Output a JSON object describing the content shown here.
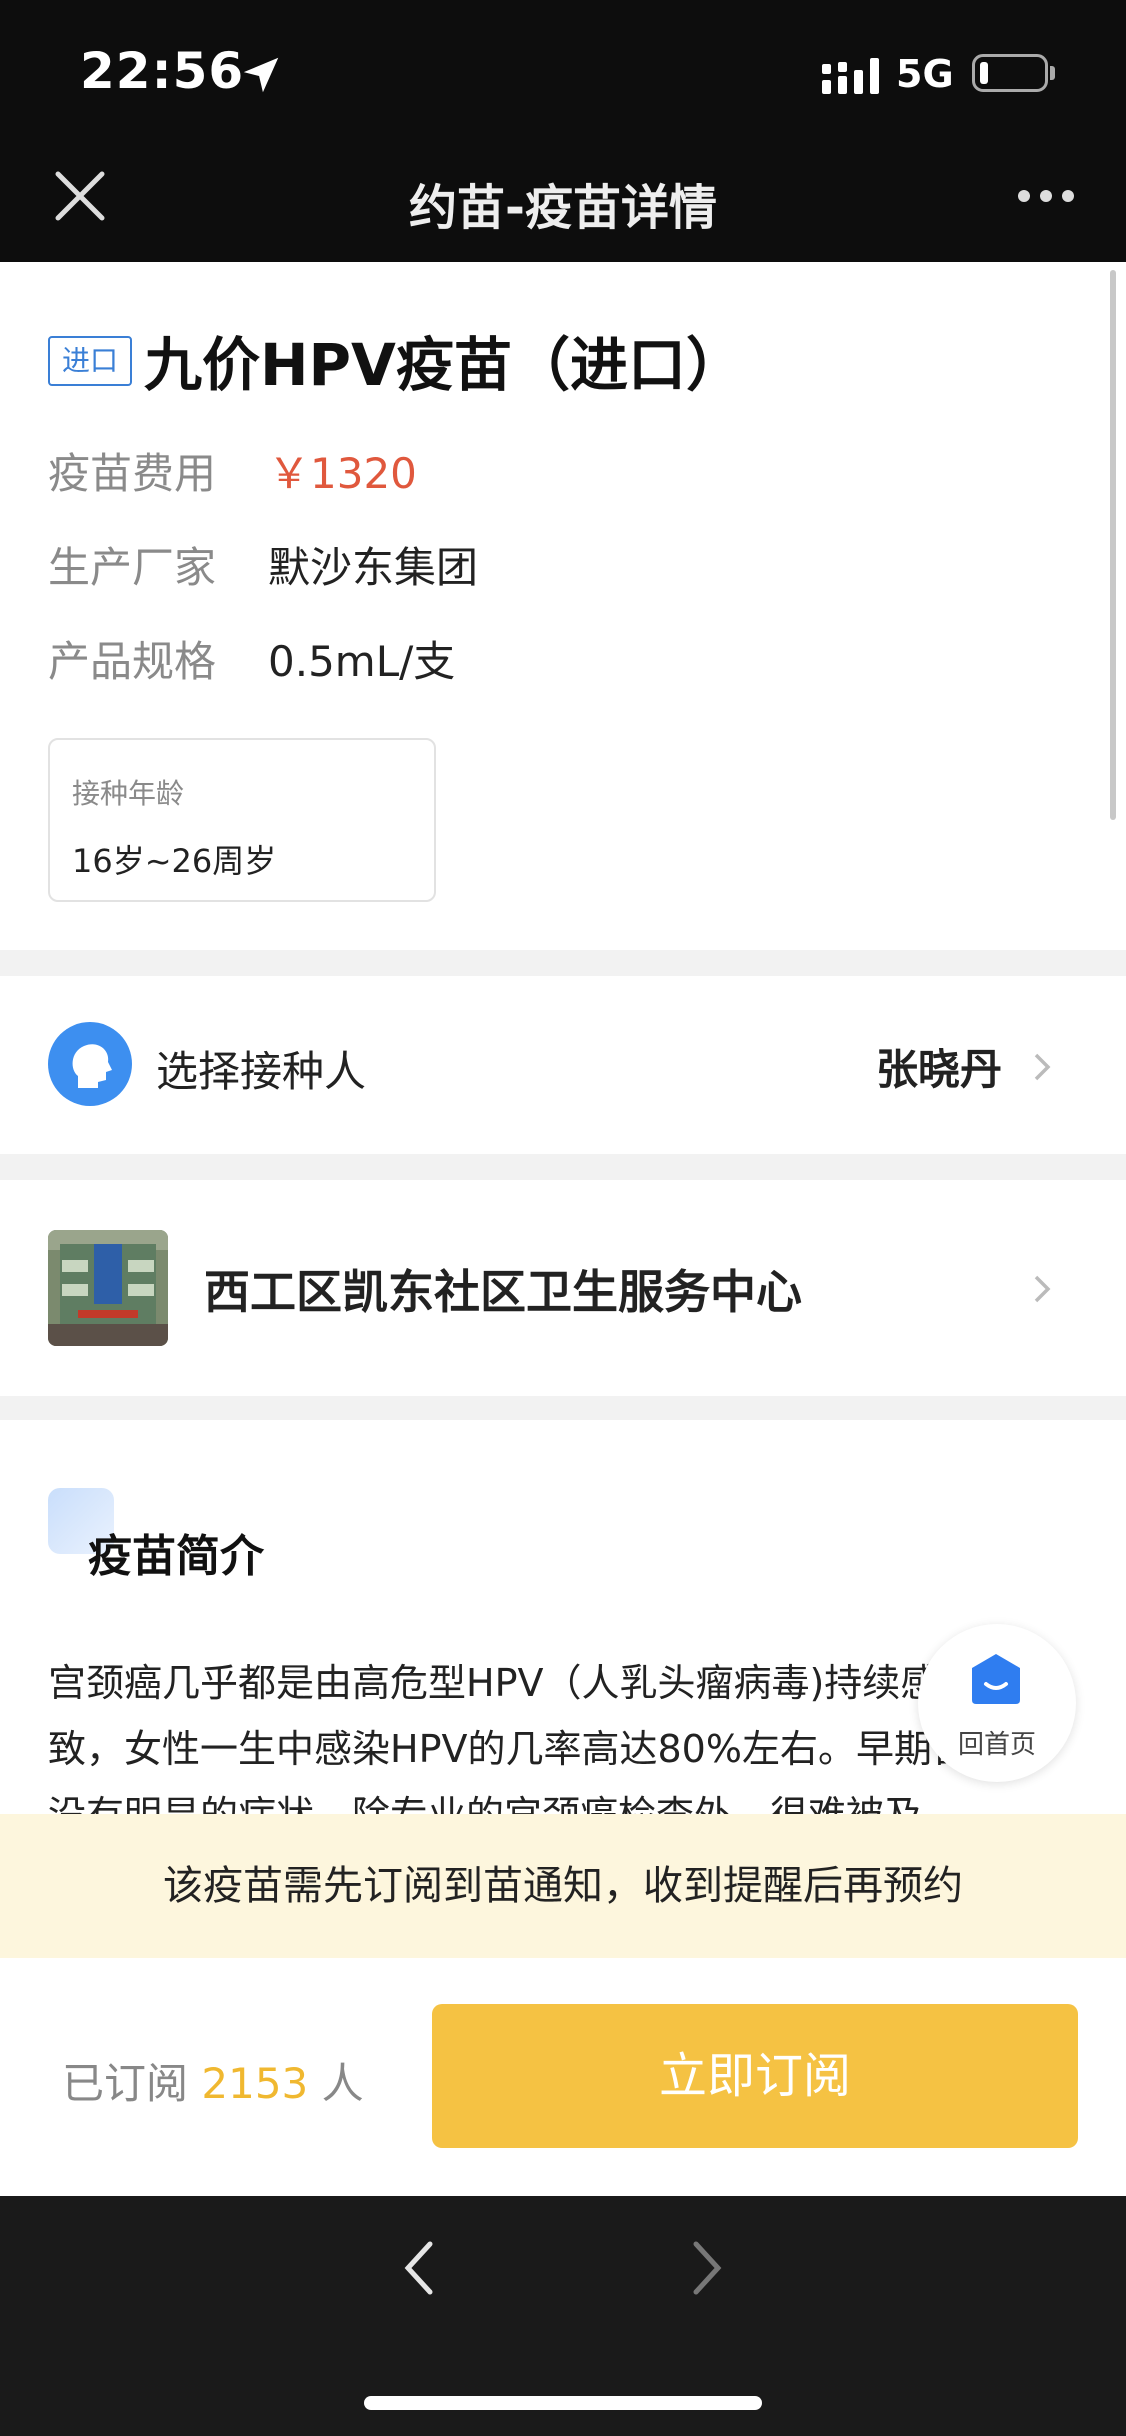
{
  "status_bar": {
    "time": "22:56",
    "network": "5G"
  },
  "nav": {
    "title": "约苗-疫苗详情"
  },
  "vaccine": {
    "tag": "进口",
    "title": "九价HPV疫苗（进口）",
    "rows": [
      {
        "label": "疫苗费用",
        "value": "￥1320"
      },
      {
        "label": "生产厂家",
        "value": "默沙东集团"
      },
      {
        "label": "产品规格",
        "value": "0.5mL/支"
      }
    ],
    "age": {
      "label": "接种年龄",
      "value": "16岁~26周岁"
    }
  },
  "recipient": {
    "label": "选择接种人",
    "name": "张晓丹"
  },
  "clinic": {
    "name": "西工区凯东社区卫生服务中心"
  },
  "intro": {
    "title": "疫苗简介",
    "text": "宫颈癌几乎都是由高危型HPV（人乳头瘤病毒)持续感染所致，女性一生中感染HPV的几率高达80%左右。早期宫颈癌没有明显的症状，除专业的宫颈癌检查外，很难被及"
  },
  "home_button": {
    "label": "回首页"
  },
  "notice": "该疫苗需先订阅到苗通知，收到提醒后再预约",
  "subscribe": {
    "prefix": "已订阅",
    "count": "2153",
    "suffix": "人",
    "button": "立即订阅"
  },
  "colors": {
    "accent": "#f5c243",
    "price": "#e0583d",
    "blue": "#3d8ff0"
  }
}
